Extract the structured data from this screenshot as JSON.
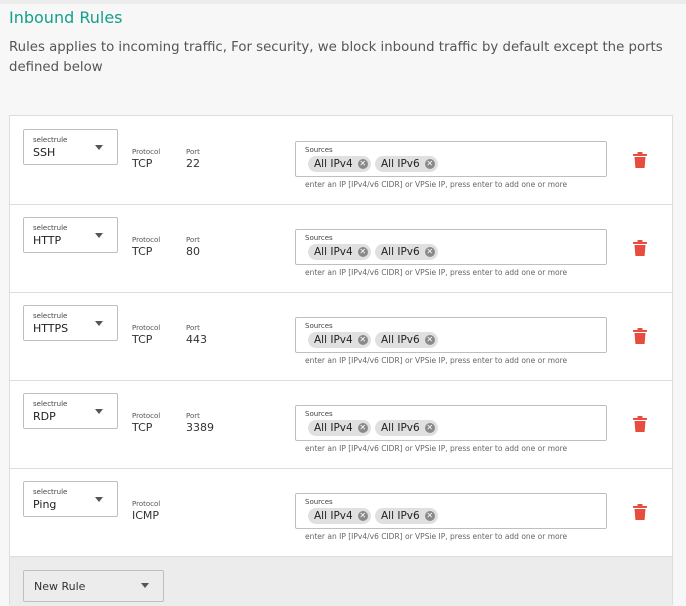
{
  "header": {
    "title": "Inbound Rules",
    "description": "Rules applies to incoming traffic, For security, we block inbound traffic by default except the ports defined below"
  },
  "rule_labels": {
    "select": "selectrule",
    "protocol": "Protocol",
    "port": "Port",
    "sources": "Sources",
    "hint": "enter an IP [IPv4/v6 CIDR] or VPSie IP, press enter to add one or more"
  },
  "rules": [
    {
      "rule": "SSH",
      "protocol": "TCP",
      "port": "22",
      "sources": [
        "All IPv4",
        "All IPv6"
      ]
    },
    {
      "rule": "HTTP",
      "protocol": "TCP",
      "port": "80",
      "sources": [
        "All IPv4",
        "All IPv6"
      ]
    },
    {
      "rule": "HTTPS",
      "protocol": "TCP",
      "port": "443",
      "sources": [
        "All IPv4",
        "All IPv6"
      ]
    },
    {
      "rule": "RDP",
      "protocol": "TCP",
      "port": "3389",
      "sources": [
        "All IPv4",
        "All IPv6"
      ]
    },
    {
      "rule": "Ping",
      "protocol": "ICMP",
      "port": null,
      "sources": [
        "All IPv4",
        "All IPv6"
      ]
    }
  ],
  "footer": {
    "new_rule_label": "New Rule"
  },
  "colors": {
    "accent": "#139f8b",
    "delete": "#e74c3c",
    "chip": "#e0e0e0"
  }
}
